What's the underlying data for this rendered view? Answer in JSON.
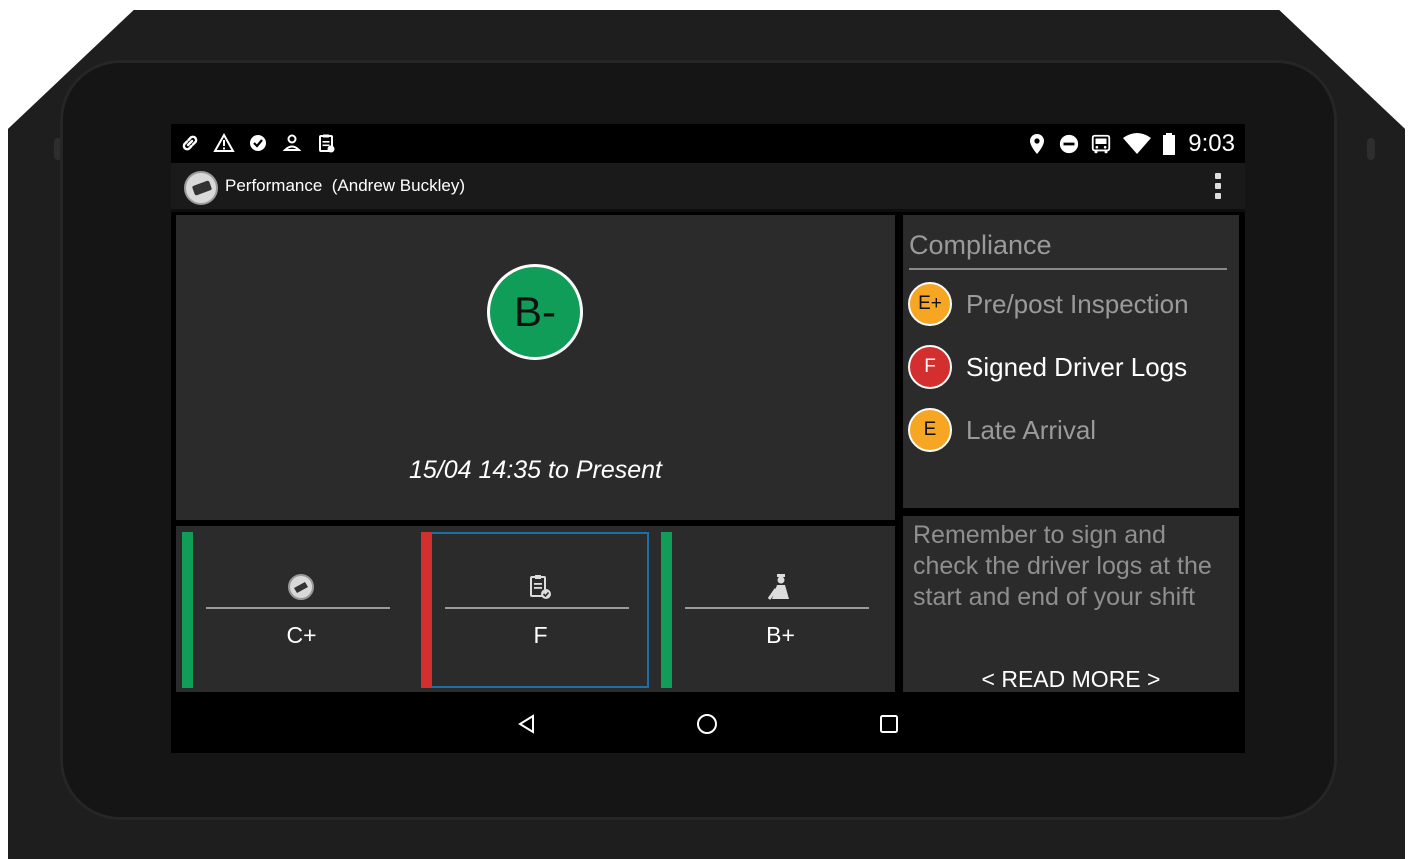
{
  "status_bar": {
    "left_icons": [
      "link-icon",
      "warning-icon",
      "check-circle-icon",
      "person-icon",
      "clipboard-icon"
    ],
    "right_icons": [
      "location-pin-icon",
      "do-not-disturb-icon",
      "bus-icon",
      "wifi-icon",
      "battery-icon"
    ],
    "time": "9:03"
  },
  "app_bar": {
    "title": "Performance  (Andrew Buckley)"
  },
  "overall": {
    "grade": "B-",
    "grade_color": "#0f9d58",
    "period": "15/04 14:35 to Present"
  },
  "compliance": {
    "title": "Compliance",
    "items": [
      {
        "grade": "E+",
        "label": "Pre/post Inspection",
        "color": "#f6a623"
      },
      {
        "grade": "F",
        "label": "Signed Driver Logs",
        "color": "#d32f2f"
      },
      {
        "grade": "E",
        "label": "Late Arrival",
        "color": "#f6a623"
      }
    ]
  },
  "tip": {
    "text": "Remember to sign and check the driver logs at the start and end of your shift",
    "read_more": "< READ MORE >"
  },
  "tiles": [
    {
      "icon": "driving-icon",
      "grade": "C+",
      "bar_color": "#0f9d58"
    },
    {
      "icon": "clipboard-check-icon",
      "grade": "F",
      "bar_color": "#d32f2f",
      "selected": true
    },
    {
      "icon": "driver-icon",
      "grade": "B+",
      "bar_color": "#0f9d58"
    }
  ],
  "nav_bar": {
    "buttons": [
      "back-icon",
      "home-icon",
      "recents-icon"
    ]
  }
}
